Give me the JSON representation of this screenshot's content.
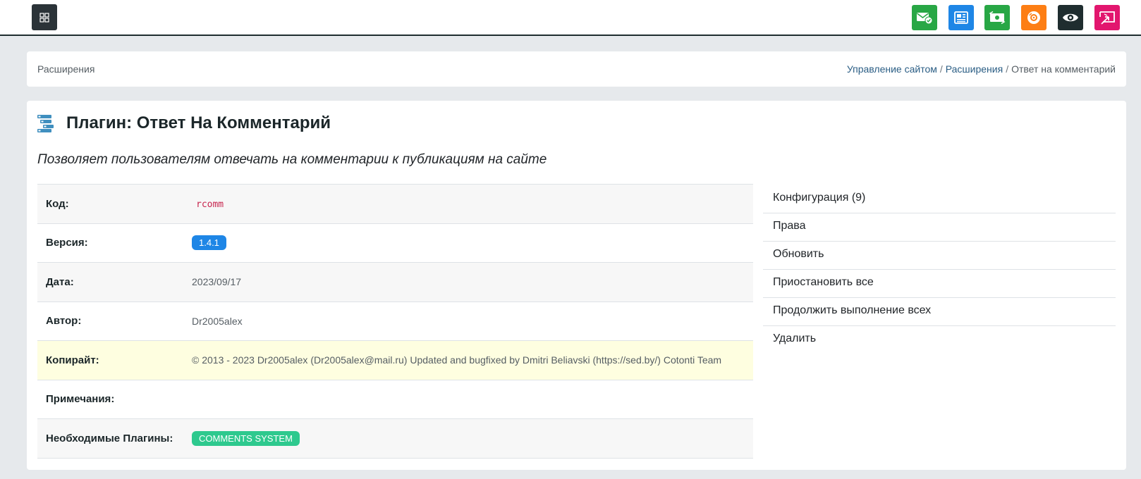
{
  "colors": {
    "topbar_border": "#1f2d2f",
    "menu_button": "#2b3338",
    "link": "#2a5d84",
    "badge_version": "#1e86e6",
    "badge_required": "#2ec98e",
    "highlight_row": "#fefee0"
  },
  "topbar": {
    "menu_icon": "grid-icon",
    "quick_buttons": [
      {
        "icon": "mail-check-icon",
        "color": "#28a745"
      },
      {
        "icon": "newspaper-icon",
        "color": "#1e86e6"
      },
      {
        "icon": "money-transfer-icon",
        "color": "#28a745"
      },
      {
        "icon": "disc-icon",
        "color": "#fd7e14"
      },
      {
        "icon": "eye-icon",
        "color": "#1f2d2f"
      },
      {
        "icon": "screen-exit-icon",
        "color": "#e2166e"
      }
    ]
  },
  "breadcrumb": {
    "section": "Расширения",
    "trail": [
      "Управление сайтом",
      "Расширения",
      "Ответ на комментарий"
    ],
    "separator": "/"
  },
  "plugin": {
    "title": "Плагин: Ответ На Комментарий",
    "description": "Позволяет пользователям отвечать на комментарии к публикациям на сайте",
    "icon": "plugin-stack-icon",
    "info": {
      "code": {
        "label": "Код:",
        "value": "rcomm"
      },
      "version": {
        "label": "Версия:",
        "value": "1.4.1"
      },
      "date": {
        "label": "Дата:",
        "value": "2023/09/17"
      },
      "author": {
        "label": "Автор:",
        "value": "Dr2005alex"
      },
      "copyright": {
        "label": "Копирайт:",
        "value": "© 2013 - 2023 Dr2005alex (Dr2005alex@mail.ru) Updated and bugfixed by Dmitri Beliavski (https://sed.by/) Cotonti Team"
      },
      "notes": {
        "label": "Примечания:",
        "value": ""
      },
      "requires": {
        "label": "Необходимые Плагины:",
        "value": "COMMENTS SYSTEM"
      }
    }
  },
  "actions": [
    "Конфигурация (9)",
    "Права",
    "Обновить",
    "Приостановить все",
    "Продолжить выполнение всех",
    "Удалить"
  ]
}
